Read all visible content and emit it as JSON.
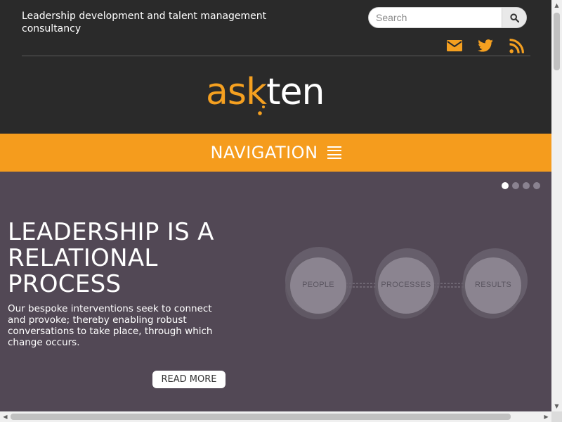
{
  "header": {
    "tagline": "Leadership development and talent management consultancy",
    "search": {
      "placeholder": "Search"
    },
    "social": [
      {
        "icon": "mail-icon"
      },
      {
        "icon": "twitter-icon"
      },
      {
        "icon": "rss-icon"
      }
    ],
    "logo": {
      "part1": "ask",
      "part2": "ten"
    }
  },
  "navigation": {
    "label": "NAVIGATION",
    "icon": "hamburger-icon"
  },
  "hero": {
    "slides_total": 4,
    "active_slide": 1,
    "title": "LEADERSHIP IS A RELATIONAL PROCESS",
    "text": "Our bespoke interventions seek to connect and provoke; thereby enabling robust conversations to take place, through which change occurs.",
    "button": "READ MORE",
    "graphic_labels": [
      "PEOPLE",
      "PROCESSES",
      "RESULTS"
    ]
  },
  "colors": {
    "accent": "#f59c1d",
    "header_bg": "#2a2a2a",
    "hero_bg": "#524855"
  }
}
